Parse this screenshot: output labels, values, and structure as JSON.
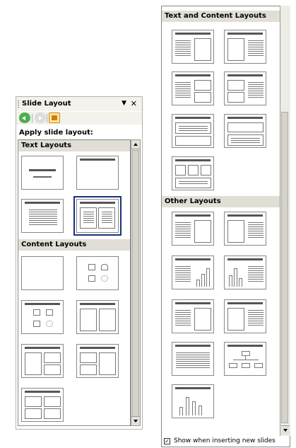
{
  "left_pane": {
    "title": "Slide Layout",
    "apply_label": "Apply slide layout:",
    "sections": {
      "text": "Text Layouts",
      "content": "Content Layouts"
    }
  },
  "right_pane": {
    "sections": {
      "text_content": "Text and Content Layouts",
      "other": "Other Layouts"
    },
    "show_when_inserting": "Show when inserting new slides",
    "show_when_inserting_checked": true
  },
  "icons": [
    "back-icon",
    "forward-icon",
    "home-icon",
    "menu-arrow-icon",
    "close-icon"
  ],
  "colors": {
    "section_header": "#e1ded6",
    "selected_outline": "#16337a",
    "pane_bg": "#f3f2ec"
  }
}
